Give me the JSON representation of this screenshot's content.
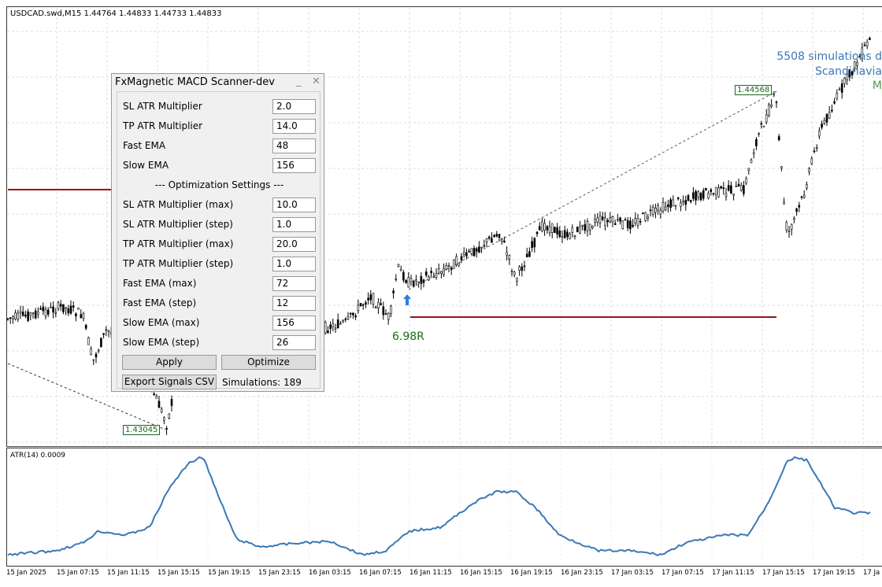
{
  "chart": {
    "symbol_line": "USDCAD.swd,M15  1.44764 1.44833 1.44733 1.44833",
    "price_label_high": "1.44568",
    "price_label_low": "1.43045",
    "result_label": "6.98R",
    "sim_text_1": "5508 simulations d",
    "sim_text_2": "Scandinavia",
    "sim_text_3": "M",
    "up_color": "#000000",
    "sl_line_color": "#a01010",
    "arrow_color": "#2a7fd4"
  },
  "atr": {
    "label": "ATR(14) 0.0009",
    "color": "#3a78b5"
  },
  "time_axis": [
    "15 Jan 2025",
    "15 Jan 07:15",
    "15 Jan 11:15",
    "15 Jan 15:15",
    "15 Jan 19:15",
    "15 Jan 23:15",
    "16 Jan 03:15",
    "16 Jan 07:15",
    "16 Jan 11:15",
    "16 Jan 15:15",
    "16 Jan 19:15",
    "16 Jan 23:15",
    "17 Jan 03:15",
    "17 Jan 07:15",
    "17 Jan 11:15",
    "17 Jan 15:15",
    "17 Jan 19:15",
    "17 Ja"
  ],
  "dialog": {
    "title": "FxMagnetic MACD Scanner-dev",
    "minimize": "_",
    "close": "✕",
    "fields": [
      {
        "label": "SL ATR Multiplier",
        "value": "2.0"
      },
      {
        "label": "TP ATR Multiplier",
        "value": "14.0"
      },
      {
        "label": "Fast EMA",
        "value": "48"
      },
      {
        "label": "Slow EMA",
        "value": "156"
      }
    ],
    "section": "--- Optimization Settings ---",
    "opt_fields": [
      {
        "label": "SL ATR Multiplier (max)",
        "value": "10.0"
      },
      {
        "label": "SL ATR Multiplier (step)",
        "value": "1.0"
      },
      {
        "label": "TP ATR Multiplier (max)",
        "value": "20.0"
      },
      {
        "label": "TP ATR Multiplier (step)",
        "value": "1.0"
      },
      {
        "label": "Fast EMA (max)",
        "value": "72"
      },
      {
        "label": "Fast EMA (step)",
        "value": "12"
      },
      {
        "label": "Slow EMA (max)",
        "value": "156"
      },
      {
        "label": "Slow EMA (step)",
        "value": "26"
      }
    ],
    "apply": "Apply",
    "optimize": "Optimize",
    "export": "Export Signals CSV",
    "simulations": "Simulations: 189"
  }
}
